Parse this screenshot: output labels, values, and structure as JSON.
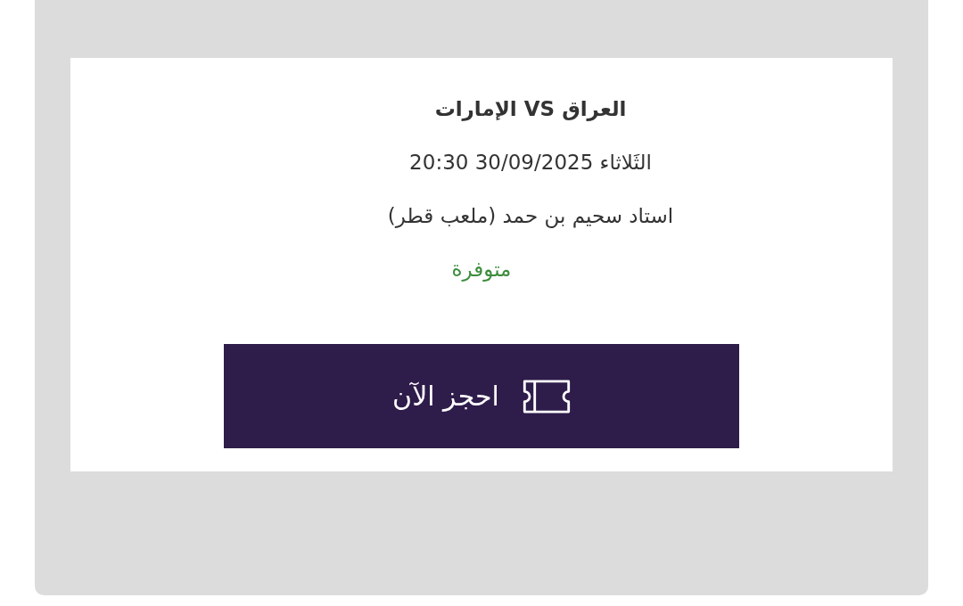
{
  "event": {
    "title": "العراق VS الإمارات",
    "datetime": "الثَلاثاء 30/09/2025 20:30",
    "venue": "استاد سحيم بن حمد (ملعب قطر)",
    "availability": {
      "text": "متوفرة",
      "kind": "available"
    },
    "book_button": {
      "label": "احجز الآن"
    }
  }
}
